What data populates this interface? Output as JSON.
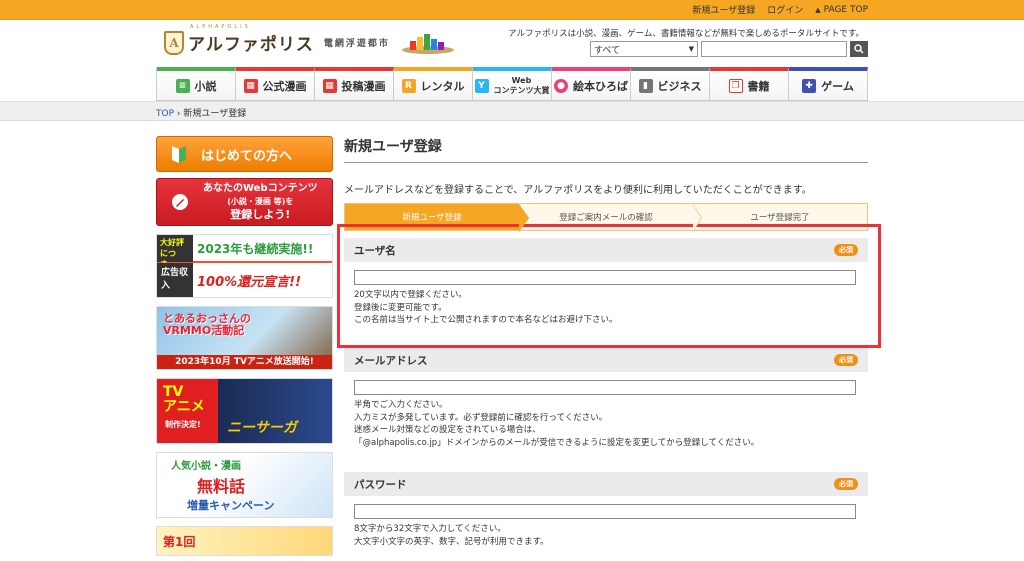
{
  "topbar": {
    "new_user": "新規ユーザ登録",
    "login": "ログイン",
    "page_top": "PAGE TOP"
  },
  "header": {
    "logo_roman": "ALPHAPOLIS",
    "logo_text": "アルファポリス",
    "logo_sub": "電網浮遊都市",
    "tagline": "アルファポリスは小説、漫画、ゲーム、書籍情報などが無料で楽しめるポータルサイトです。",
    "search_select": "すべて"
  },
  "nav": {
    "items": [
      {
        "label": "小説",
        "color": "#4caf50"
      },
      {
        "label": "公式漫画",
        "color": "#e53935"
      },
      {
        "label": "投稿漫画",
        "color": "#e53935"
      },
      {
        "label": "レンタル",
        "color": "#f5a623"
      },
      {
        "label_line1": "Web",
        "label_line2": "コンテンツ大賞",
        "color": "#29b6f6"
      },
      {
        "label": "絵本ひろば",
        "color": "#ec407a"
      },
      {
        "label": "ビジネス",
        "color": "#757575"
      },
      {
        "label": "書籍",
        "color": "#e53935"
      },
      {
        "label": "ゲーム",
        "color": "#3f51b5"
      }
    ]
  },
  "breadcrumb": {
    "top": "TOP",
    "sep": "›",
    "current": "新規ユーザ登録"
  },
  "sidebar": {
    "first_time": "はじめての方へ",
    "web_line1": "あなたのWebコンテンツ",
    "web_line2": "(小説・漫画 等)を",
    "web_line3": "登録しよう!",
    "banner1": {
      "tl": "大好評につき、",
      "tr": "2023年も継続実施!!",
      "bl": "広告収入",
      "br": "100%還元宣言!!"
    },
    "banner2": {
      "title1": "とあるおっさんの",
      "title2": "VRMMO活動記",
      "bottom": "2023年10月 TVアニメ放送開始!"
    },
    "banner3": {
      "title1": "TV",
      "title2": "アニメ",
      "sub": "制作決定!",
      "name": "ニーサーガ"
    },
    "banner4": {
      "top": "人気小説・漫画",
      "main": "無料話",
      "bottom": "増量キャンペーン"
    },
    "banner5": {
      "title": "第1回"
    }
  },
  "main": {
    "title": "新規ユーザ登録",
    "intro": "メールアドレスなどを登録することで、アルファポリスをより便利に利用していただくことができます。",
    "steps": [
      "新規ユーザ登録",
      "登録ご案内メールの確認",
      "ユーザ登録完了"
    ],
    "required": "必須",
    "username": {
      "label": "ユーザ名",
      "notes": [
        "20文字以内で登録ください。",
        "登録後に変更可能です。",
        "この名前は当サイト上で公開されますので本名などはお避け下さい。"
      ]
    },
    "email": {
      "label": "メールアドレス",
      "notes": [
        "半角でご入力ください。",
        "入力ミスが多発しています。必ず登録前に確認を行ってください。",
        "迷惑メール対策などの設定をされている場合は、",
        "「@alphapolis.co.jp」ドメインからのメールが受信できるように設定を変更してから登録してください。"
      ]
    },
    "password": {
      "label": "パスワード",
      "notes": [
        "8文字から32文字で入力してください。",
        "大文字小文字の英字、数字、記号が利用できます。"
      ]
    }
  }
}
